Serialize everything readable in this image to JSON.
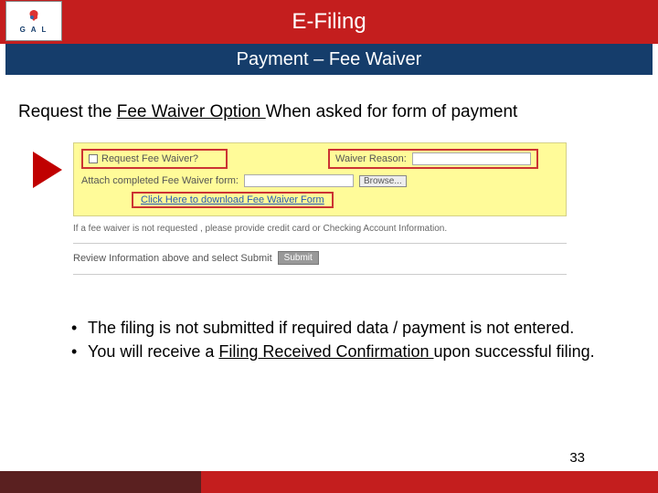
{
  "header": {
    "logo_text": "G A L",
    "title": "E-Filing",
    "subtitle": "Payment – Fee Waiver"
  },
  "instruction": {
    "prefix": "Request the ",
    "underlined": "Fee Waiver Option ",
    "suffix": "When asked for form of payment"
  },
  "form": {
    "request_label": "Request Fee Waiver?",
    "reason_label": "Waiver Reason:",
    "attach_label": "Attach completed Fee Waiver form:",
    "browse_label": "Browse...",
    "download_text": "Click Here to download Fee Waiver Form",
    "note": "If a fee waiver is not requested , please provide credit card or Checking Account Information.",
    "review_text": "Review Information above and select Submit",
    "submit_label": "Submit"
  },
  "bullets": {
    "b1_prefix": "The filing is not submitted if required data / payment is not entered.",
    "b2_prefix": "You will receive a ",
    "b2_underlined": "Filing Received Confirmation ",
    "b2_suffix": "upon successful filing."
  },
  "page_number": "33"
}
